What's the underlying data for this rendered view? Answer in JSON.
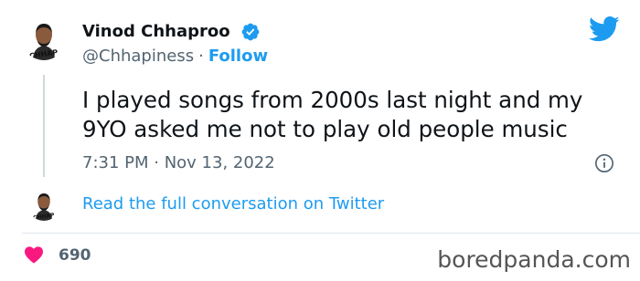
{
  "tweet": {
    "author": {
      "name": "Vinod Chhaproo",
      "handle": "@Chhapiness",
      "separator": "·",
      "follow_label": "Follow",
      "verified": true,
      "avatar_text": "Chhapiness"
    },
    "text_lines": [
      "I played songs from 2000s last night and my",
      "9YO asked me not to play old people music"
    ],
    "timestamp": "7:31 PM · Nov 13, 2022",
    "read_more_label": "Read the full conversation on Twitter",
    "likes": "690"
  },
  "watermark": "boredpanda.com",
  "colors": {
    "accent": "#1d9bf0",
    "heart": "#f91880",
    "secondary_text": "#536471"
  },
  "icons": {
    "brand": "twitter-bird-icon",
    "verified": "verified-badge-icon",
    "info": "info-icon",
    "like": "heart-icon"
  }
}
